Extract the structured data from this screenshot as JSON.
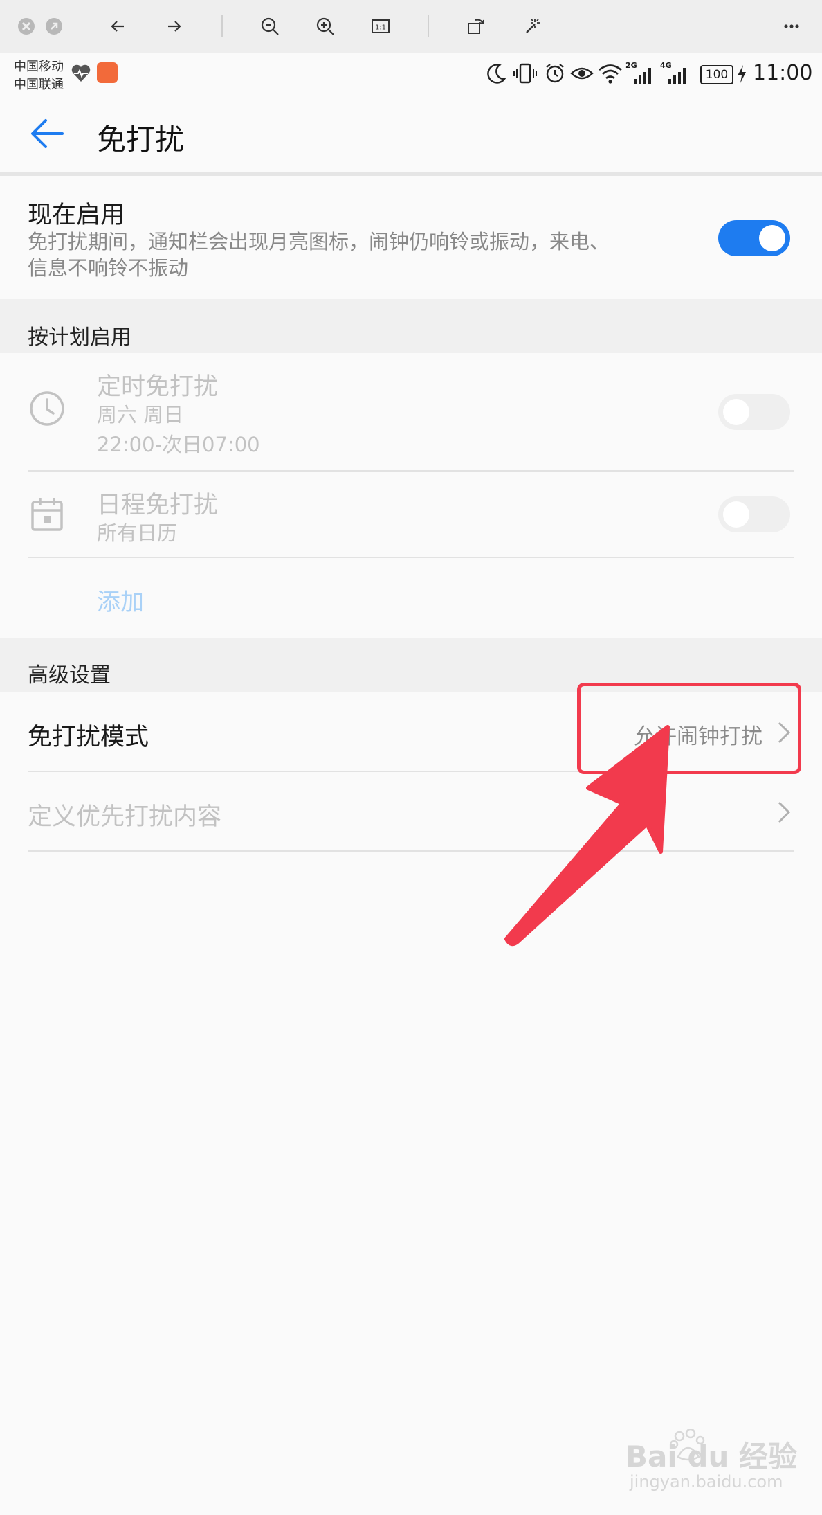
{
  "viewer_toolbar": {
    "icons": [
      "close-icon",
      "minimize-icon",
      "back-arrow-icon",
      "forward-arrow-icon",
      "zoom-out-icon",
      "zoom-in-icon",
      "actual-size-icon",
      "rotate-icon",
      "magic-wand-icon",
      "more-icon"
    ],
    "actual_size_label": "1:1"
  },
  "status_bar": {
    "carrier1": "中国移动",
    "carrier2": "中国联通",
    "net1": "2G",
    "net2": "4G",
    "battery": "100",
    "time": "11:00"
  },
  "app_bar": {
    "title": "免打扰"
  },
  "enable_now": {
    "title": "现在启用",
    "description_line1": "免打扰期间，通知栏会出现月亮图标，闹钟仍响铃或振动，来电、",
    "description_line2": "信息不响铃不振动",
    "enabled": true
  },
  "scheduled": {
    "section_label": "按计划启用",
    "timed": {
      "title": "定时免打扰",
      "days": "周六 周日",
      "time_range": "22:00-次日07:00",
      "enabled": false
    },
    "calendar": {
      "title": "日程免打扰",
      "subtitle": "所有日历",
      "enabled": false
    },
    "add_label": "添加"
  },
  "advanced": {
    "section_label": "高级设置",
    "mode": {
      "title": "免打扰模式",
      "value": "允许闹钟打扰"
    },
    "priority": {
      "title": "定义优先打扰内容"
    }
  },
  "colors": {
    "accent": "#1e7cf0",
    "highlight": "#f23a4d",
    "disabled_text": "#c2c2c2"
  },
  "watermark": {
    "brand": "Bai du 经验",
    "url": "jingyan.baidu.com"
  }
}
